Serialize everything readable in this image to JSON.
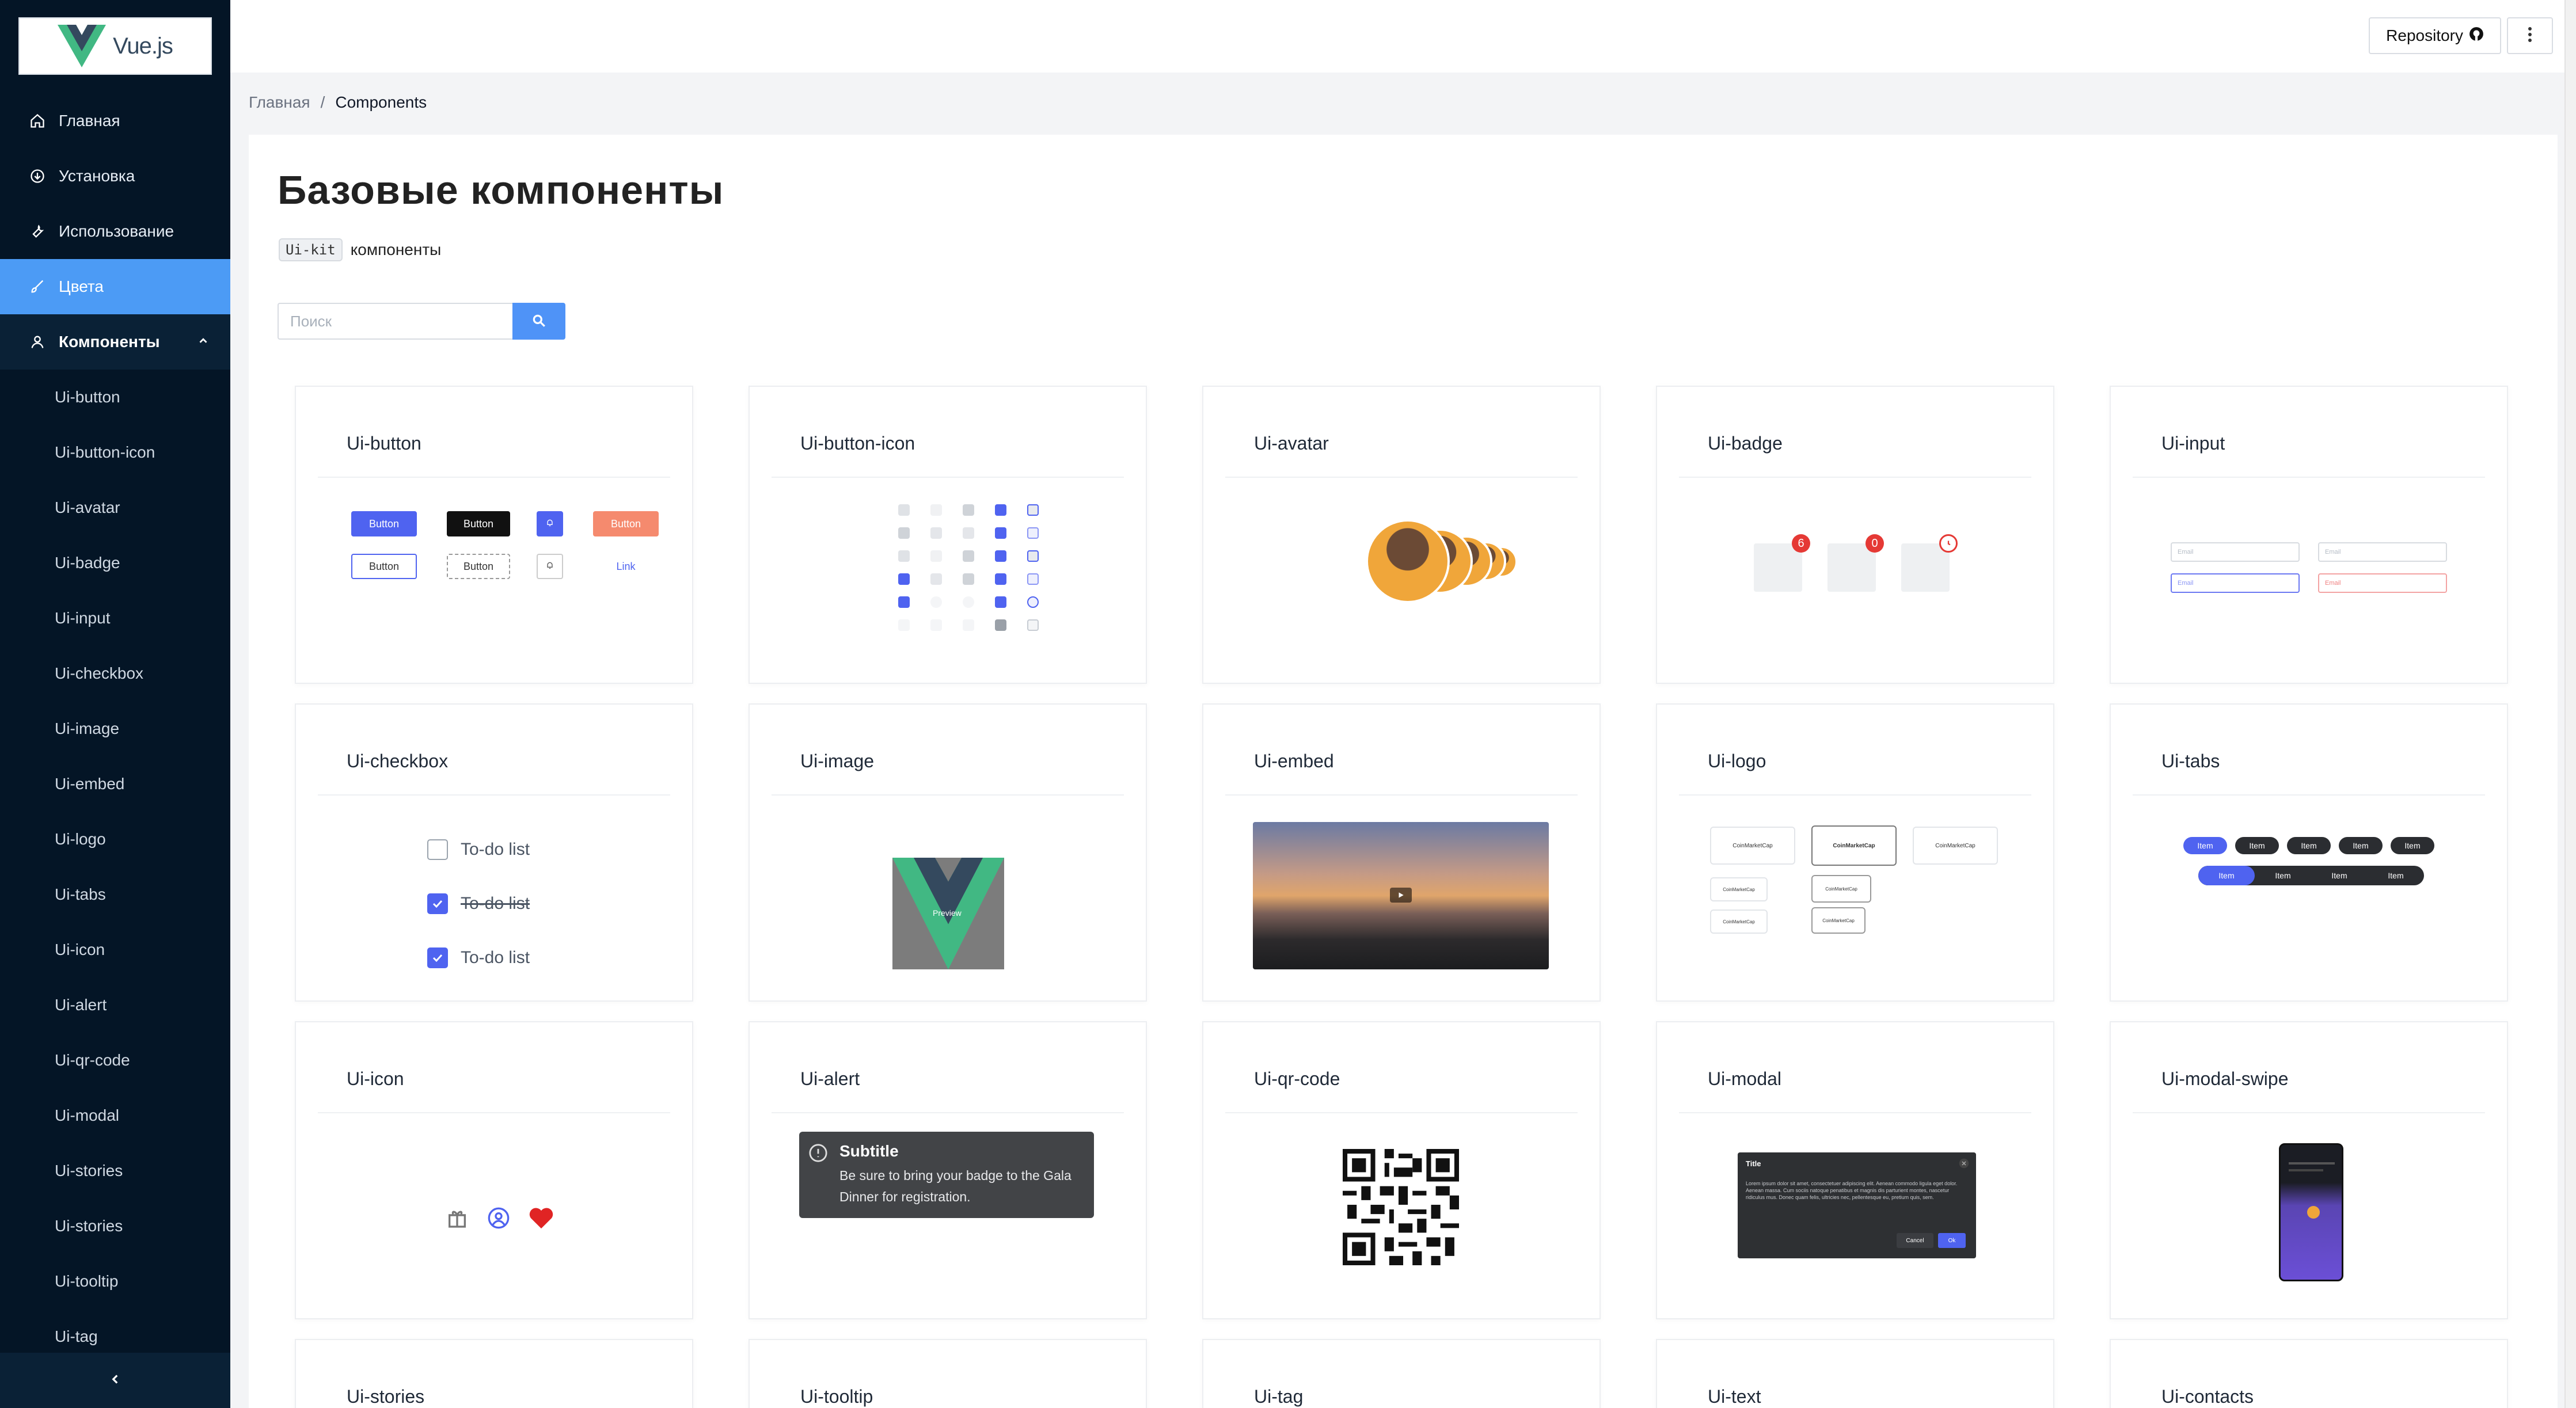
{
  "app": {
    "logo_text": "Vue.js"
  },
  "sidebar": {
    "items": [
      {
        "label": "Главная",
        "icon": "home-icon"
      },
      {
        "label": "Установка",
        "icon": "cloud-download-icon"
      },
      {
        "label": "Использование",
        "icon": "wrench-icon"
      },
      {
        "label": "Цвета",
        "icon": "brush-icon",
        "active": true
      },
      {
        "label": "Компоненты",
        "icon": "user-icon",
        "expanded": true
      }
    ],
    "sub_items": [
      "Ui-button",
      "Ui-button-icon",
      "Ui-avatar",
      "Ui-badge",
      "Ui-input",
      "Ui-checkbox",
      "Ui-image",
      "Ui-embed",
      "Ui-logo",
      "Ui-tabs",
      "Ui-icon",
      "Ui-alert",
      "Ui-qr-code",
      "Ui-modal",
      "Ui-stories",
      "Ui-stories",
      "Ui-tooltip",
      "Ui-tag"
    ]
  },
  "topbar": {
    "repository_label": "Repository"
  },
  "breadcrumb": {
    "home": "Главная",
    "separator": "/",
    "current": "Components"
  },
  "page": {
    "title": "Базовые компоненты",
    "subtitle_code": "Ui-kit",
    "subtitle_text": "компоненты",
    "search_placeholder": "Поиск"
  },
  "cards": [
    {
      "title": "Ui-button"
    },
    {
      "title": "Ui-button-icon"
    },
    {
      "title": "Ui-avatar"
    },
    {
      "title": "Ui-badge"
    },
    {
      "title": "Ui-input"
    },
    {
      "title": "Ui-checkbox"
    },
    {
      "title": "Ui-image"
    },
    {
      "title": "Ui-embed"
    },
    {
      "title": "Ui-logo"
    },
    {
      "title": "Ui-tabs"
    },
    {
      "title": "Ui-icon"
    },
    {
      "title": "Ui-alert"
    },
    {
      "title": "Ui-qr-code"
    },
    {
      "title": "Ui-modal"
    },
    {
      "title": "Ui-modal-swipe"
    },
    {
      "title": "Ui-stories"
    },
    {
      "title": "Ui-tooltip"
    },
    {
      "title": "Ui-tag"
    },
    {
      "title": "Ui-text"
    },
    {
      "title": "Ui-contacts"
    }
  ],
  "previews": {
    "button": {
      "primary": "Button",
      "dark": "Button",
      "secondary": "Button",
      "outline": "Button",
      "dashed": "Button",
      "link": "Link"
    },
    "badge": {
      "count1": "6",
      "count2": "0"
    },
    "input": {
      "placeholder": "Email"
    },
    "checkbox": {
      "items": [
        "To-do list",
        "To-do list",
        "To-do list"
      ]
    },
    "image": {
      "preview_label": "Preview"
    },
    "logo": {
      "brand": "CoinMarketCap"
    },
    "tabs": {
      "item": "Item"
    },
    "alert": {
      "title": "Subtitle",
      "body": "Be sure to bring your badge to the Gala Dinner for registration."
    },
    "modal": {
      "title": "Title",
      "body": "Lorem ipsum dolor sit amet, consectetuer adipiscing elit. Aenean commodo ligula eget dolor. Aenean massa. Cum sociis natoque penatibus et magnis dis parturient montes, nascetur ridiculus mus. Donec quam felis, ultricies nec, pellentesque eu, pretium quis, sem.",
      "cancel": "Cancel",
      "ok": "Ok"
    }
  },
  "colors": {
    "accent": "#4c9bf5",
    "sidebar_bg": "#041526",
    "primary": "#4f63f0",
    "danger": "#e53935",
    "coral": "#f58a6e"
  }
}
